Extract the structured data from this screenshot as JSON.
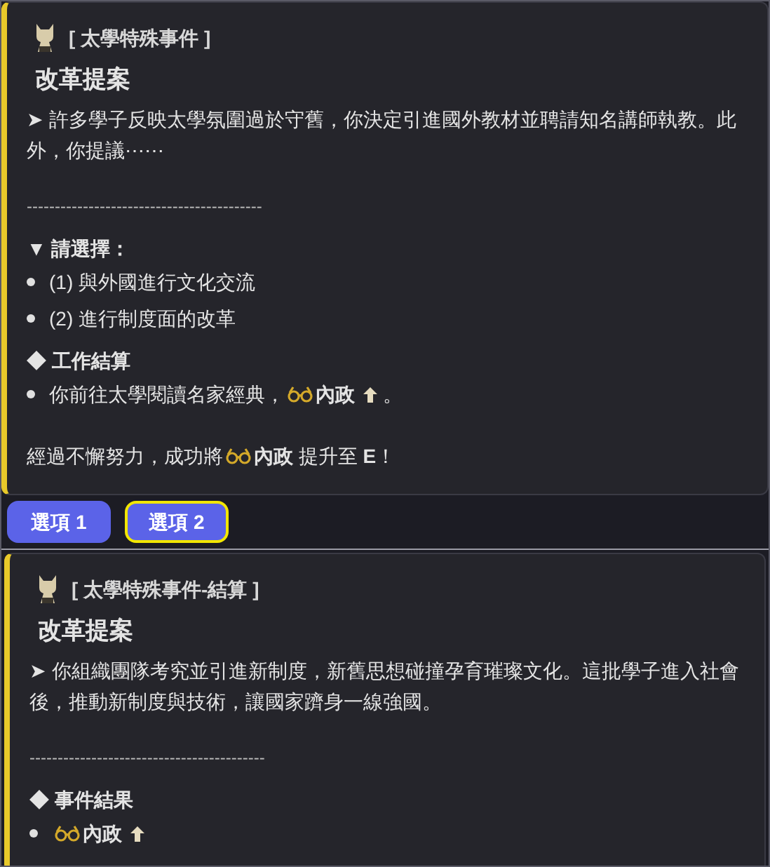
{
  "cards": [
    {
      "header": "[ 太學特殊事件 ]",
      "title": "改革提案",
      "body": "➤ 許多學子反映太學氛圍過於守舊，你決定引進國外教材並聘請知名講師執教。此外，你提議⋯⋯",
      "divider": "------------------------------------------",
      "sections": [
        {
          "heading": "▼ 請選擇：",
          "items": [
            {
              "kind": "text",
              "text": "(1) 與外國進行文化交流"
            },
            {
              "kind": "text",
              "text": "(2) 進行制度面的改革"
            }
          ]
        },
        {
          "heading": "◆ 工作結算",
          "items": [
            {
              "kind": "stat",
              "before": "你前往太學閱讀名家經典，",
              "stat": "內政",
              "after": "。"
            }
          ]
        }
      ],
      "footer": {
        "before": "經過不懈努力，成功將",
        "stat": "內政",
        "after": "提升至 **E**！"
      }
    },
    {
      "header": "[ 太學特殊事件-結算 ]",
      "title": "改革提案",
      "body": "➤ 你組織團隊考究並引進新制度，新舊思想碰撞孕育璀璨文化。這批學子進入社會後，推動新制度與技術，讓國家躋身一線強國。",
      "divider": "------------------------------------------",
      "sections": [
        {
          "heading": "◆ 事件結果",
          "items": [
            {
              "kind": "stat",
              "stat": "內政"
            }
          ]
        }
      ]
    }
  ],
  "choices": [
    {
      "label": "選項 1",
      "selected": false
    },
    {
      "label": "選項 2",
      "selected": true
    }
  ]
}
